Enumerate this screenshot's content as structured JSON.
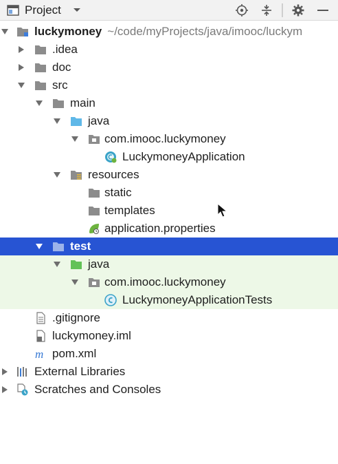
{
  "panel": {
    "title": "Project",
    "icons": [
      "project-view-icon",
      "dropdown-caret-icon",
      "locate-target-icon",
      "collapse-all-icon",
      "settings-gear-icon",
      "minimize-icon"
    ]
  },
  "tree": {
    "root_name": "luckymoney",
    "root_path": "~/code/myProjects/java/imooc/luckym",
    "idea": ".idea",
    "doc": "doc",
    "src": "src",
    "main": "main",
    "main_java": "java",
    "main_pkg": "com.imooc.luckymoney",
    "main_class": "LuckymoneyApplication",
    "resources": "resources",
    "static": "static",
    "templates": "templates",
    "app_props": "application.properties",
    "test": "test",
    "test_java": "java",
    "test_pkg": "com.imooc.luckymoney",
    "test_class": "LuckymoneyApplicationTests",
    "gitignore": ".gitignore",
    "iml": "luckymoney.iml",
    "pom": "pom.xml",
    "ext_libs": "External Libraries",
    "scratches": "Scratches and Consoles"
  },
  "colors": {
    "selection": "#2754d3",
    "test_tint": "#edf8e7",
    "folder_gray": "#8c8c8c",
    "folder_blue": "#5fb8e8",
    "folder_green": "#62c257",
    "spring_green": "#6db33f"
  }
}
